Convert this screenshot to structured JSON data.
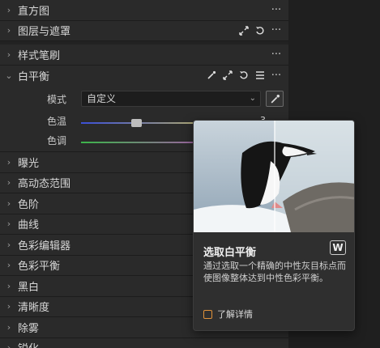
{
  "panels": {
    "histogram": "直方图",
    "layers_masks": "图层与遮罩",
    "style_brush": "样式笔刷",
    "white_balance": "白平衡",
    "exposure": "曝光",
    "hdr": "高动态范围",
    "levels": "色阶",
    "curves": "曲线",
    "color_editor": "色彩编辑器",
    "color_balance": "色彩平衡",
    "bw": "黑白",
    "clarity": "清晰度",
    "dehaze": "除雾",
    "sharpen": "锐化"
  },
  "white_balance": {
    "mode_label": "模式",
    "mode_value": "自定义",
    "temp_label": "色温",
    "tint_label": "色调",
    "temp_value_partial": "3"
  },
  "tooltip": {
    "title": "选取白平衡",
    "shortcut": "W",
    "description": "通过选取一个精确的中性灰目标点而使图像整体达到中性色彩平衡。",
    "link": "了解详情"
  },
  "colors": {
    "accent_link": "#e0913a",
    "temp_gradient_start": "#3b4fd6",
    "temp_gradient_end": "#d9c94a",
    "tint_gradient_start": "#3cb54a",
    "tint_gradient_end": "#c040c0"
  },
  "icons": [
    "chevron-right-icon",
    "chevron-down-icon",
    "more-icon",
    "expand-icon",
    "reset-icon",
    "eyedropper-icon",
    "list-icon",
    "external-link-icon"
  ]
}
